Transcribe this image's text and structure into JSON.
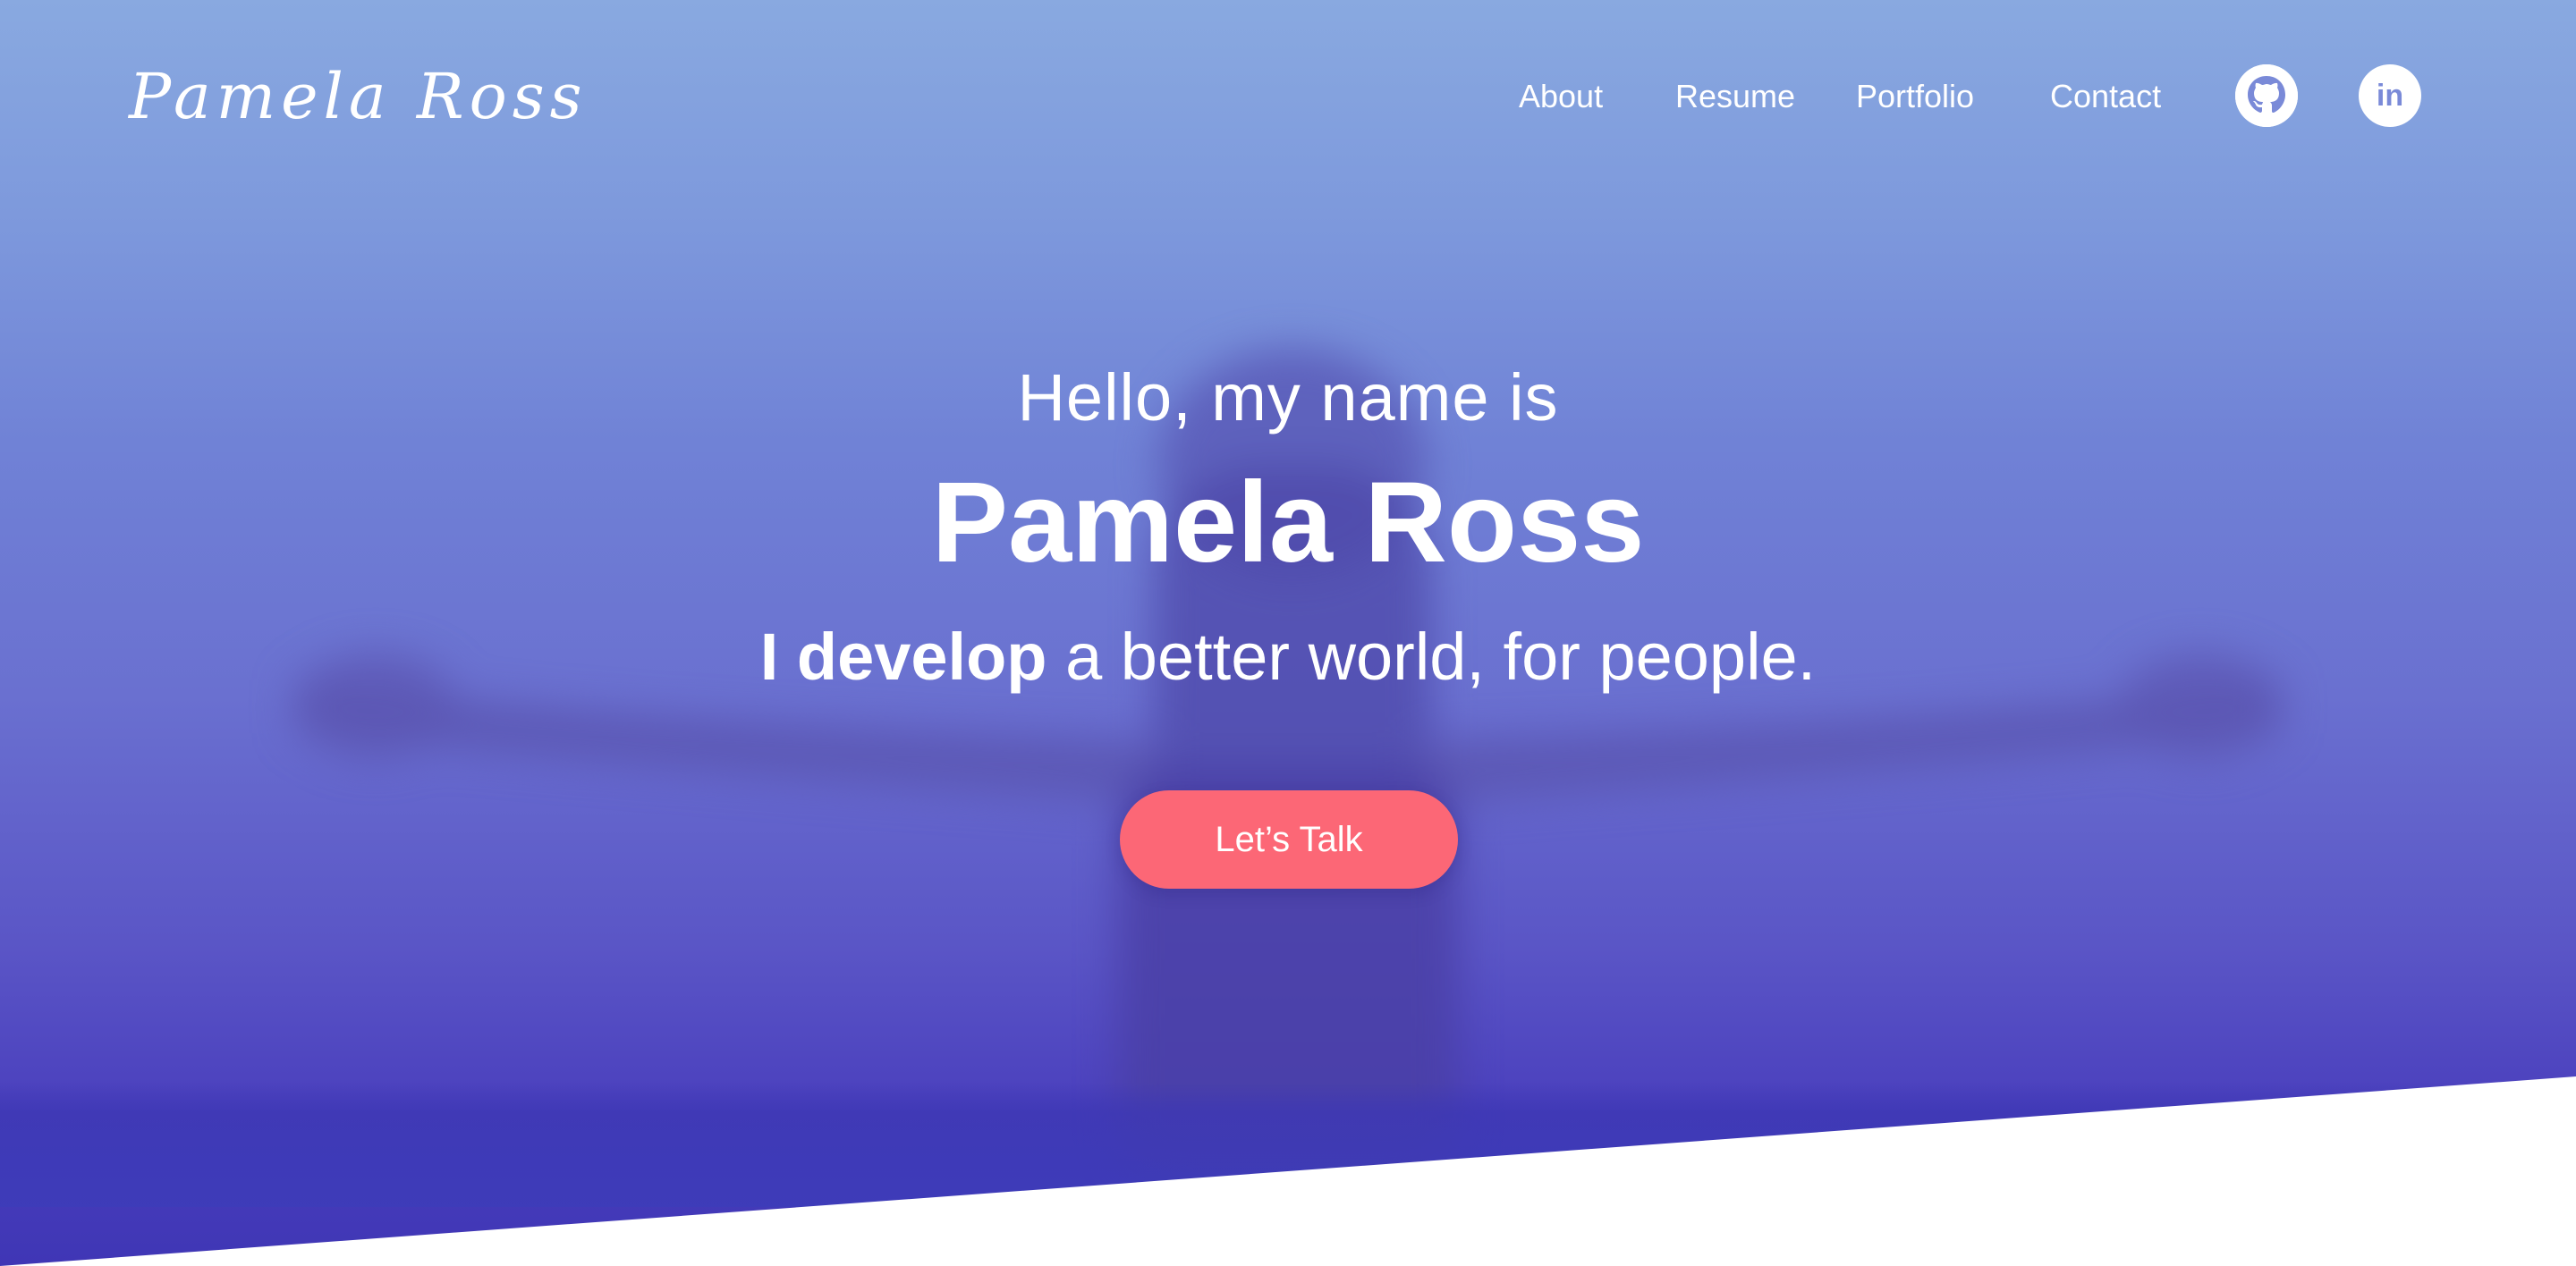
{
  "header": {
    "logo_text": "Pamela Ross",
    "nav": [
      {
        "label": "About"
      },
      {
        "label": "Resume"
      },
      {
        "label": "Portfolio"
      },
      {
        "label": "Contact"
      }
    ],
    "social": [
      {
        "icon": "github-icon"
      },
      {
        "icon": "linkedin-icon",
        "glyph": "in"
      }
    ]
  },
  "hero": {
    "greeting": "Hello, my name is",
    "name": "Pamela Ross",
    "tagline_bold": "I develop",
    "tagline_rest": " a better world, for people.",
    "cta_label": "Let’s Talk"
  },
  "colors": {
    "cta": "#fc6776",
    "hero_top": "#89a9e0",
    "hero_bottom": "#3f36b5",
    "text": "#ffffff"
  }
}
